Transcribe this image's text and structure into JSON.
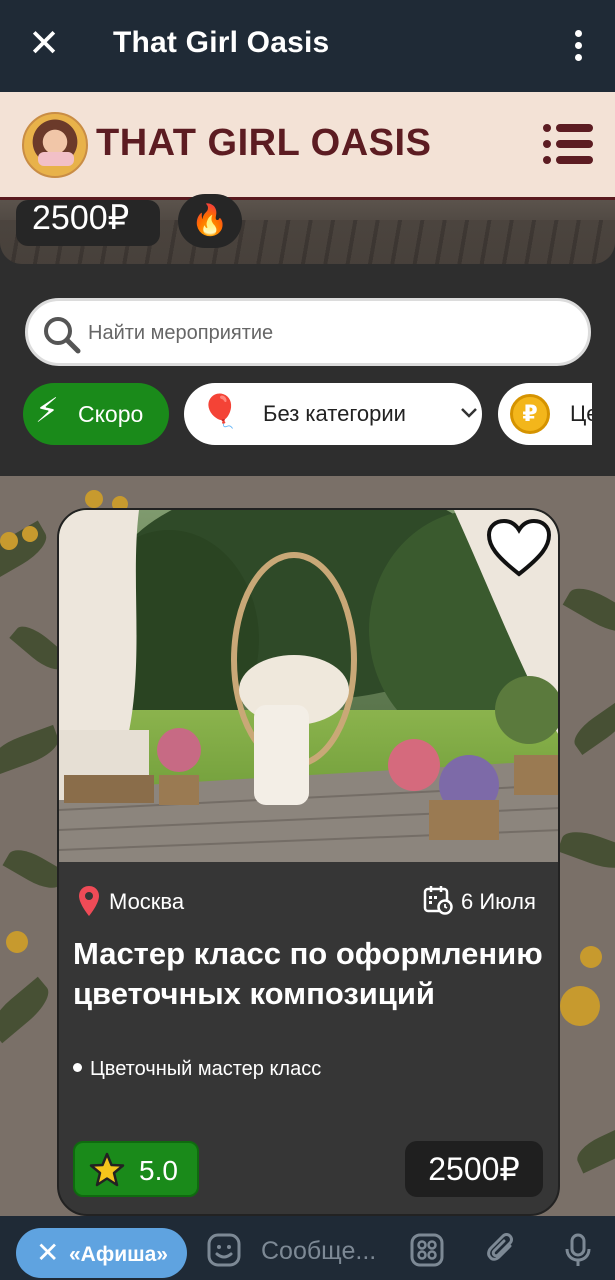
{
  "tg_header": {
    "title": "That Girl Oasis"
  },
  "site": {
    "brand": "THAT GIRL OASIS"
  },
  "previous_card": {
    "price": "2500₽",
    "hot_icon": "fire-icon"
  },
  "search": {
    "placeholder": "Найти мероприятие"
  },
  "filters": {
    "soon": {
      "label": "Скоро",
      "icon": "lightning-icon"
    },
    "category": {
      "label": "Без категории",
      "icon": "balloon-icon"
    },
    "price": {
      "label": "Цена",
      "icon": "ruble-coin-icon"
    }
  },
  "event": {
    "location": "Москва",
    "date": "6 Июля",
    "title": "Мастер класс по оформлению цветочных композиций",
    "category": "Цветочный мастер класс",
    "rating": "5.0",
    "price": "2500₽"
  },
  "bottom_bar": {
    "chip_label": "«Афиша»",
    "message_placeholder": "Сообще..."
  },
  "colors": {
    "tg_bar": "#1f2a36",
    "site_header": "#f3e2d6",
    "brand_text": "#5c1c22",
    "accent_green": "#1a8a1a",
    "card_bg": "#363636",
    "chip_blue": "#5fa3e0"
  }
}
